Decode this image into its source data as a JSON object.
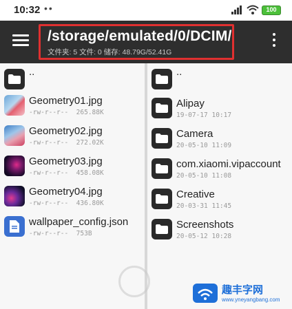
{
  "status_bar": {
    "time": "10:32",
    "dots": "••",
    "network": "HD",
    "battery": "100"
  },
  "toolbar": {
    "path": "/storage/emulated/0/DCIM/",
    "info": "文件夹: 5  文件: 0  储存: 48.79G/52.41G",
    "menu_icon": "hamburger-menu-icon",
    "more_icon": "more-vertical-icon"
  },
  "left_pane": {
    "parent": "..",
    "files": [
      {
        "name": "Geometry01.jpg",
        "perm": "-rw-r--r--",
        "size": "265.88K"
      },
      {
        "name": "Geometry02.jpg",
        "perm": "-rw-r--r--",
        "size": "272.02K"
      },
      {
        "name": "Geometry03.jpg",
        "perm": "-rw-r--r--",
        "size": "458.08K"
      },
      {
        "name": "Geometry04.jpg",
        "perm": "-rw-r--r--",
        "size": "436.80K"
      },
      {
        "name": "wallpaper_config.json",
        "perm": "-rw-r--r--",
        "size": "753B"
      }
    ]
  },
  "right_pane": {
    "parent": "..",
    "folders": [
      {
        "name": "Alipay",
        "date": "19-07-17 10:17"
      },
      {
        "name": "Camera",
        "date": "20-05-10 11:09"
      },
      {
        "name": "com.xiaomi.vipaccount",
        "date": "20-05-10 11:08"
      },
      {
        "name": "Creative",
        "date": "20-03-31 11:45"
      },
      {
        "name": "Screenshots",
        "date": "20-05-12 10:28"
      }
    ]
  },
  "watermark": {
    "text": "趣丰字网",
    "url": "www.yneyangbang.com"
  },
  "colors": {
    "toolbar": "#2e2e2e",
    "highlight_border": "#e03030",
    "battery": "#4cc03a"
  }
}
